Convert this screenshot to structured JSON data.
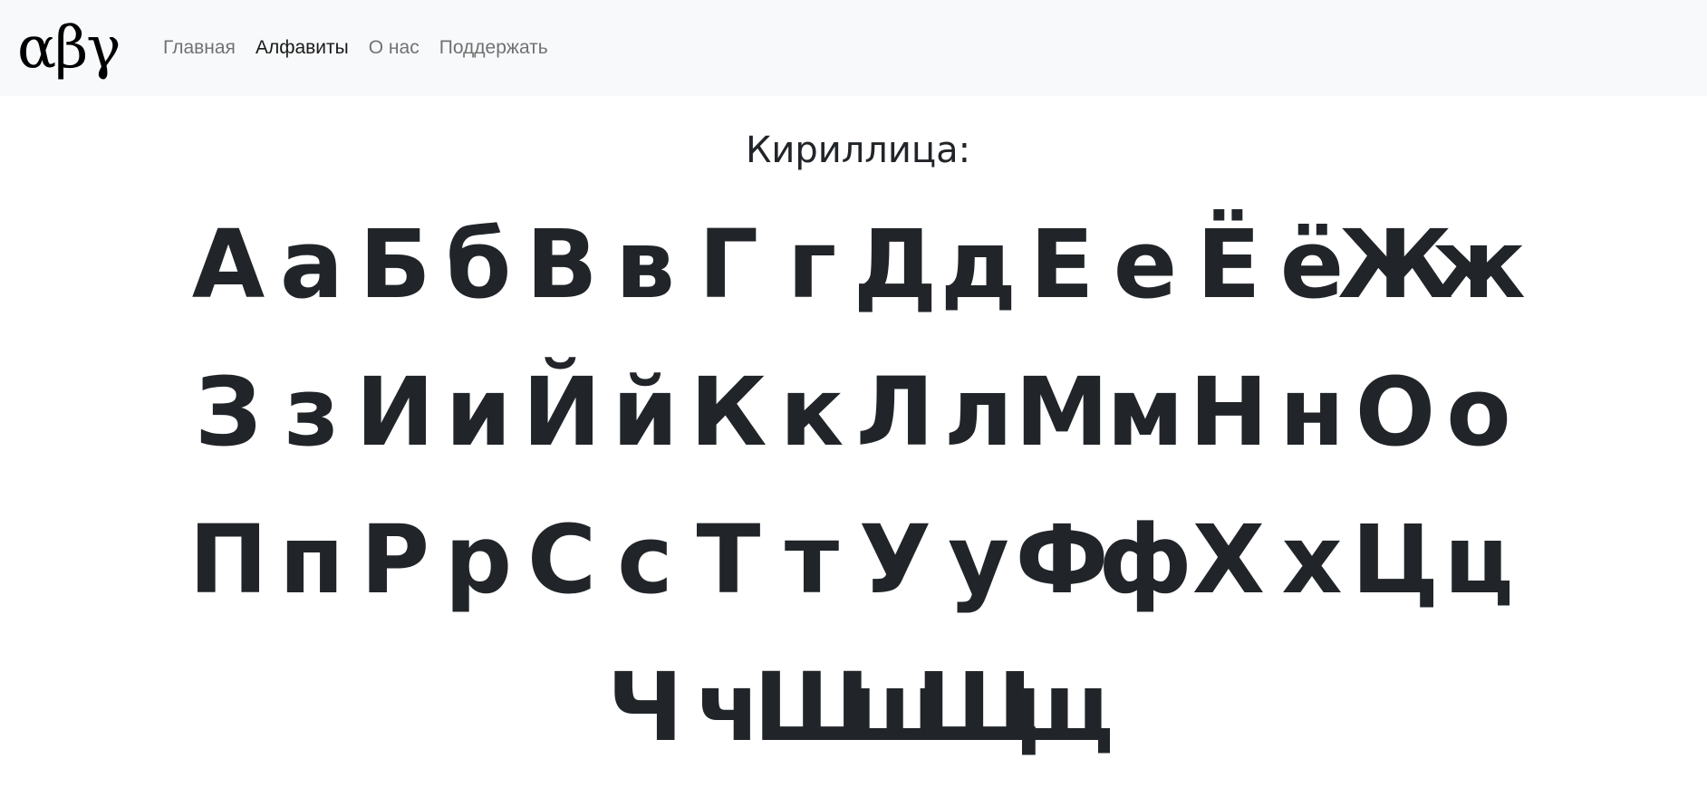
{
  "navbar": {
    "brand": "αβγ",
    "links": [
      {
        "label": "Главная",
        "active": false
      },
      {
        "label": "Алфавиты",
        "active": true
      },
      {
        "label": "О нас",
        "active": false
      },
      {
        "label": "Поддержать",
        "active": false
      }
    ]
  },
  "main": {
    "heading": "Кириллица:",
    "letters": [
      "А",
      "а",
      "Б",
      "б",
      "В",
      "в",
      "Г",
      "г",
      "Д",
      "д",
      "Е",
      "е",
      "Ё",
      "ё",
      "Ж",
      "ж",
      "З",
      "з",
      "И",
      "и",
      "Й",
      "й",
      "К",
      "к",
      "Л",
      "л",
      "М",
      "м",
      "Н",
      "н",
      "О",
      "о",
      "П",
      "п",
      "Р",
      "р",
      "С",
      "с",
      "Т",
      "т",
      "У",
      "у",
      "Ф",
      "ф",
      "Х",
      "х",
      "Ц",
      "ц",
      "Ч",
      "ч",
      "Ш",
      "ш",
      "Щ",
      "щ"
    ]
  }
}
